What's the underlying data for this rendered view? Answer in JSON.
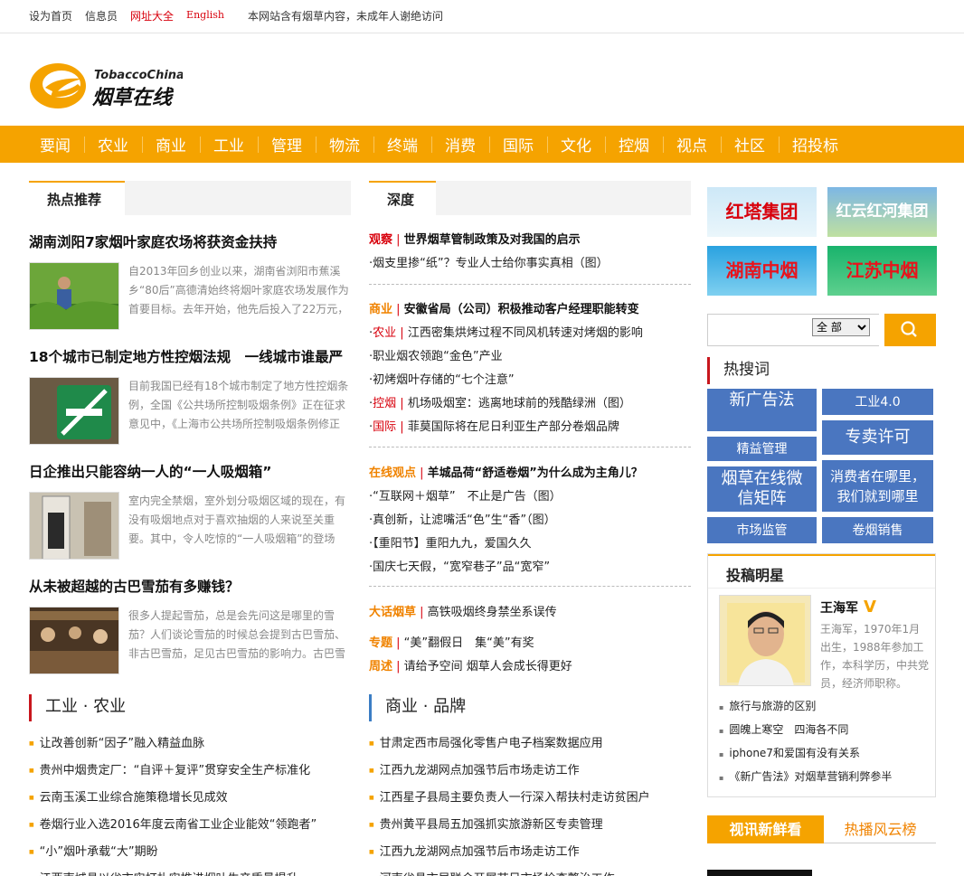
{
  "topbar": {
    "homepage": "设为首页",
    "informant": "信息员",
    "directory": "网址大全",
    "english": "English",
    "notice": "本网站含有烟草内容，未成年人谢绝访问"
  },
  "logo": {
    "brand_en": "TobaccoChina",
    "brand_cn": "烟草在线"
  },
  "nav": [
    "要闻",
    "农业",
    "商业",
    "工业",
    "管理",
    "物流",
    "终端",
    "消费",
    "国际",
    "文化",
    "控烟",
    "视点",
    "社区",
    "招投标"
  ],
  "hot": {
    "title": "热点推荐",
    "items": [
      {
        "title": "湖南浏阳7家烟叶家庭农场将获资金扶持",
        "summary": "自2013年回乡创业以来，湖南省浏阳市蕉溪乡“80后”高德清始终将烟叶家庭农场发展作为首要目标。去年开始，他先后投入了22万元，"
      },
      {
        "title": "18个城市已制定地方性控烟法规　一线城市谁最严",
        "summary": "目前我国已经有18个城市制定了地方性控烟条例，全国《公共场所控制吸烟条例》正在征求意见中，《上海市公共场所控制吸烟条例修正"
      },
      {
        "title": "日企推出只能容纳一人的“一人吸烟箱”",
        "summary": "室内完全禁烟，室外划分吸烟区域的现在，有没有吸烟地点对于喜欢抽烟的人来说至关重要。其中，令人吃惊的“一人吸烟箱”的登场"
      },
      {
        "title": "从未被超越的古巴雪茄有多赚钱？",
        "summary": "很多人提起雪茄，总是会先问这是哪里的雪茄？人们谈论雪茄的时候总会提到古巴雪茄、非古巴雪茄，足见古巴雪茄的影响力。古巴雪"
      }
    ]
  },
  "depth": {
    "title": "深度",
    "g1": {
      "cat": "观察",
      "headline": "世界烟草管制政策及对我国的启示",
      "items": [
        "烟支里掺“纸”？专业人士给你事实真相（图）"
      ]
    },
    "g2": {
      "cat": "商业",
      "headline": "安徽省局（公司）积极推动客户经理职能转变",
      "items": [
        {
          "cat": "农业",
          "text": "江西密集烘烤过程不同风机转速对烤烟的影响"
        },
        {
          "cat": "",
          "text": "职业烟农领跑“金色”产业"
        },
        {
          "cat": "",
          "text": "初烤烟叶存储的“七个注意”"
        },
        {
          "cat": "控烟",
          "text": "机场吸烟室：逃离地球前的残酷绿洲（图）"
        },
        {
          "cat": "国际",
          "text": "菲莫国际将在尼日利亚生产部分卷烟品牌"
        }
      ]
    },
    "g3": {
      "cat": "在线观点",
      "headline": "羊城品荷“舒适卷烟”为什么成为主角儿？",
      "items": [
        "“互联网＋烟草”　不止是广告（图）",
        "真创新，让滤嘴活“色”生“香”（图）",
        "【重阳节】重阳九九，爱国久久",
        "国庆七天假，“宽窄巷子”品“宽窄”"
      ]
    },
    "g4": [
      {
        "cat": "大话烟草",
        "text": "高铁吸烟终身禁坐系误传"
      },
      {
        "cat": "专题",
        "text": "“美”翻假日　集“美”有奖"
      },
      {
        "cat": "周述",
        "text": "请给予空间 烟草人会成长得更好"
      }
    ]
  },
  "industry": {
    "title": "工业 · 农业",
    "items": [
      "让改善创新“因子”融入精益血脉",
      "贵州中烟贵定厂：“自评＋复评”贯穿安全生产标准化",
      "云南玉溪工业综合施策稳增长见成效",
      "卷烟行业入选2016年度云南省工业企业能效“领跑者”",
      "“小”烟叶承载“大”期盼",
      "江西南城县以省市实打扎实推进烟叶生产质量提升"
    ]
  },
  "business": {
    "title": "商业 · 品牌",
    "items": [
      "甘肃定西市局强化零售户电子档案数据应用",
      "江西九龙湖网点加强节后市场走访工作",
      "江西星子县局主要负责人一行深入帮扶村走访贫困户",
      "贵州黄平县局五加强抓实旅游新区专卖管理",
      "江西九龙湖网点加强节后市场走访工作",
      "河南省县市局联合开展节日市场检查整治工作"
    ]
  },
  "ads": [
    "红塔集团",
    "红云红河集团",
    "湖南中烟",
    "江苏中烟"
  ],
  "search": {
    "scope": "全 部"
  },
  "hotwords": {
    "title": "热搜词",
    "tiles": [
      "新广告法",
      "工业4.0",
      "精益管理",
      "专卖许可",
      "烟草在线微信矩阵",
      "消费者在哪里，我们就到哪里",
      "市场监管",
      "卷烟销售"
    ]
  },
  "star": {
    "title": "投稿明星",
    "name": "王海军",
    "badge": "V",
    "bio": "王海军，1970年1月出生，1988年参加工作，本科学历，中共党员，经济师职称。",
    "links": [
      "旅行与旅游的区别",
      "圆魄上寒空　四海各不同",
      "iphone7和爱国有没有关系",
      "《新广告法》对烟草营销利弊参半"
    ]
  },
  "video": {
    "tab_active": "视讯新鲜看",
    "tab_other": "热播风云榜"
  },
  "colors": {
    "accent": "#f5a300",
    "red": "#d8000c",
    "tile": "#4a76c0"
  }
}
